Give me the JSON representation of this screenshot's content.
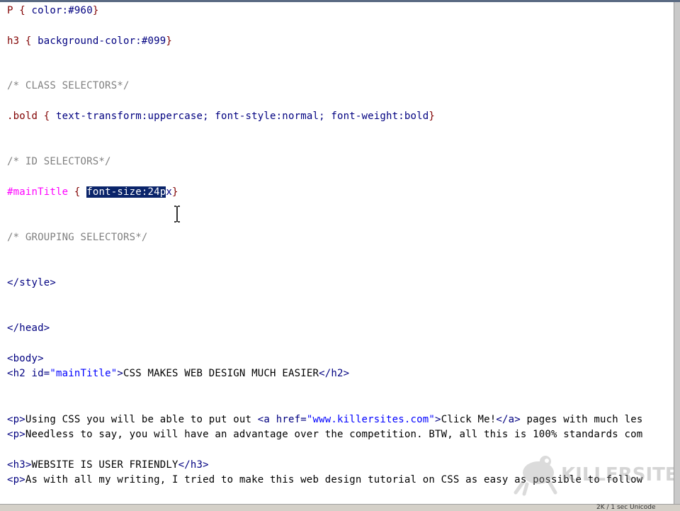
{
  "editor": {
    "css": {
      "p_rule": {
        "selector": "P",
        "open": " { ",
        "body": "color:#960",
        "close": "}"
      },
      "h3_rule": {
        "selector": "h3",
        "open": " { ",
        "body": "background-color:#099",
        "close": "}"
      },
      "comment_class": "/* CLASS SELECTORS*/",
      "bold_rule": {
        "selector": ".bold",
        "open": " { ",
        "body": "text-transform:uppercase; font-style:normal; font-weight:bold",
        "close": "}"
      },
      "comment_id": "/* ID SELECTORS*/",
      "id_rule": {
        "selector": "#mainTitle",
        "open": " { ",
        "selected": "font-size:24p",
        "rest": "x",
        "close": "}"
      },
      "comment_grouping": "/* GROUPING SELECTORS*/"
    },
    "html": {
      "style_close": "</style>",
      "head_close": "</head>",
      "body_open": "<body>",
      "h2": {
        "open": "<h2 ",
        "attr": "id=",
        "val": "\"mainTitle\"",
        "gt": ">",
        "text": "CSS MAKES WEB DESIGN MUCH EASIER",
        "close": "</h2>"
      },
      "p1": {
        "open": "<p>",
        "text1": "Using CSS you will be able to put out ",
        "a_open": "<a ",
        "attr": "href=",
        "val": "\"www.killersites.com\"",
        "gt": ">",
        "a_text": "Click Me!",
        "a_close": "</a>",
        "text2": " pages with much les"
      },
      "p2": {
        "open": "<p>",
        "text": "Needless to say, you will have an advantage over the competition. BTW, all this is 100% standards com"
      },
      "h3": {
        "open": "<h3>",
        "text": "WEBSITE IS USER FRIENDLY",
        "close": "</h3>"
      },
      "p3": {
        "open": "<p>",
        "text": "As with all my writing, I tried to make this web design tutorial on CSS as easy as possible to follow"
      }
    }
  },
  "watermark": {
    "text": "KILLERSITES.CO"
  },
  "status": {
    "text": "2K / 1 sec  Unicode"
  },
  "colors": {
    "selection": "#0a246a",
    "selector": "#800000",
    "id_selector": "#ff00ff",
    "comment": "#808080"
  }
}
